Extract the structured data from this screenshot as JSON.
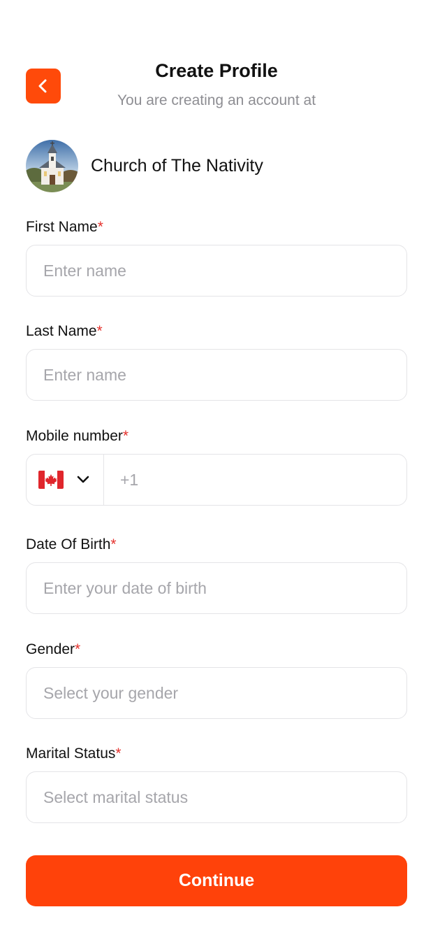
{
  "header": {
    "title": "Create Profile",
    "subtitle": "You are creating an account at",
    "back_icon": "chevron-left-icon"
  },
  "church": {
    "name": "Church of The Nativity"
  },
  "form": {
    "required_marker": "*",
    "first_name": {
      "label": "First Name",
      "placeholder": "Enter name"
    },
    "last_name": {
      "label": "Last Name",
      "placeholder": "Enter name"
    },
    "mobile": {
      "label": "Mobile number",
      "country_flag": "canada-flag-icon",
      "dropdown_icon": "chevron-down-icon",
      "placeholder": "+1"
    },
    "dob": {
      "label": "Date Of Birth",
      "placeholder": "Enter your date of birth"
    },
    "gender": {
      "label": "Gender",
      "placeholder": "Select your gender"
    },
    "marital_status": {
      "label": "Marital Status",
      "placeholder": "Select marital status"
    }
  },
  "actions": {
    "continue_label": "Continue"
  },
  "colors": {
    "accent": "#ff4a0a",
    "required": "#e5322d",
    "placeholder": "#a6a6ab",
    "border": "#e4e4e7"
  }
}
